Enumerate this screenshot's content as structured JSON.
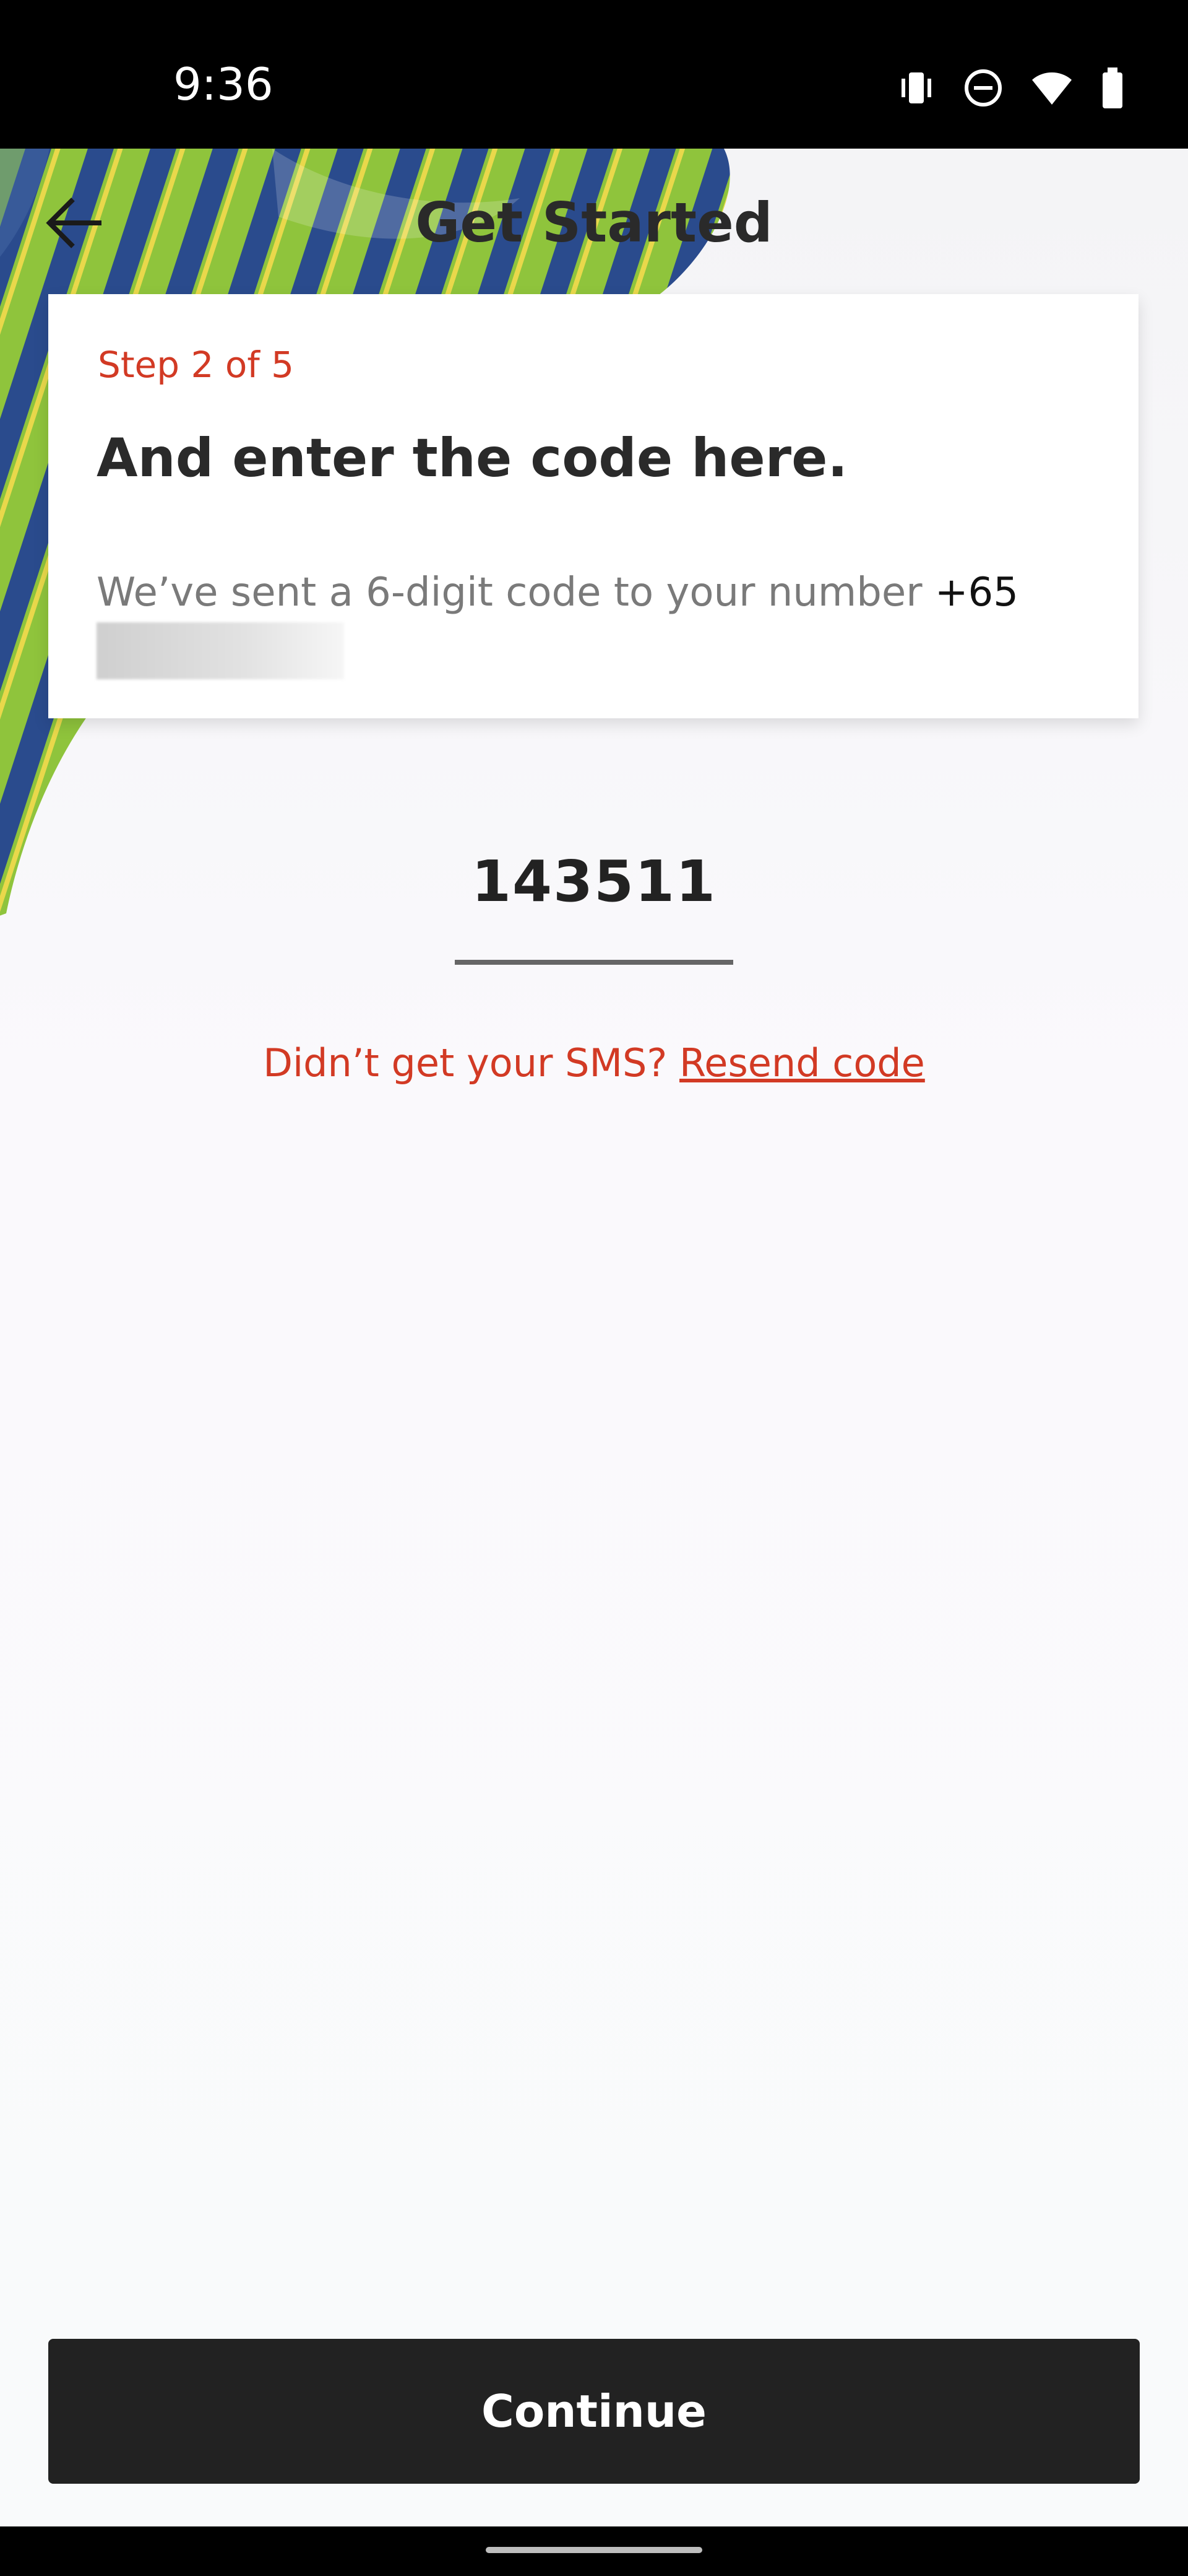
{
  "status_bar": {
    "time": "9:36",
    "icons": [
      "vibrate-icon",
      "do-not-disturb-icon",
      "wifi-icon",
      "battery-icon"
    ]
  },
  "header": {
    "title": "Get Started",
    "back_icon": "arrow-left-icon"
  },
  "card": {
    "step": "Step 2 of 5",
    "headline": "And enter the code here.",
    "description": "We’ve sent a 6-digit code to your number",
    "phone_prefix": "+65"
  },
  "code": {
    "value": "143511"
  },
  "resend": {
    "prompt": "Didn’t get your SMS?",
    "link": "Resend code"
  },
  "footer": {
    "continue_label": "Continue"
  },
  "colors": {
    "accent": "#d23a24",
    "button": "#222222"
  }
}
